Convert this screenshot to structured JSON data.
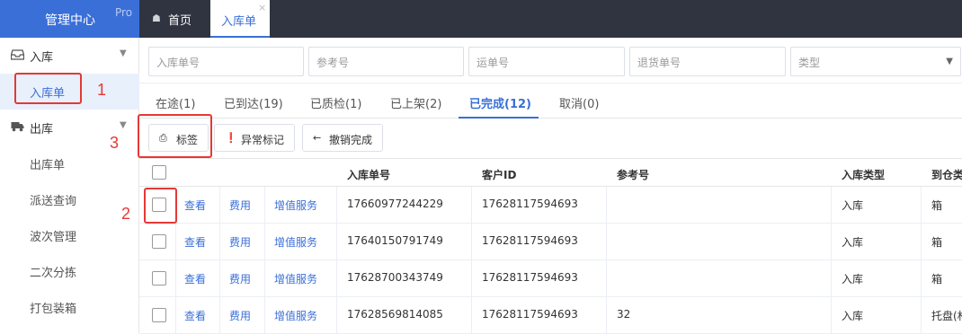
{
  "header": {
    "brand_title": "管理中心",
    "brand_badge": "Pro",
    "tabs": [
      {
        "label": "首页",
        "icon": "home-icon"
      },
      {
        "label": "入库单",
        "active": true,
        "icon": "close-icon"
      }
    ]
  },
  "sidebar": {
    "groups": [
      {
        "label": "入库",
        "icon": "inbox-icon",
        "items": [
          {
            "label": "入库单",
            "active": true
          }
        ]
      },
      {
        "label": "出库",
        "icon": "truck-icon",
        "items": [
          {
            "label": "出库单"
          },
          {
            "label": "派送查询"
          },
          {
            "label": "波次管理"
          },
          {
            "label": "二次分拣"
          },
          {
            "label": "打包装箱"
          }
        ]
      }
    ]
  },
  "filters": [
    {
      "placeholder": "入库单号"
    },
    {
      "placeholder": "参考号"
    },
    {
      "placeholder": "运单号"
    },
    {
      "placeholder": "退货单号"
    },
    {
      "placeholder": "类型",
      "type": "select"
    }
  ],
  "status_tabs": [
    {
      "label": "在途(1)"
    },
    {
      "label": "已到达(19)"
    },
    {
      "label": "已质检(1)"
    },
    {
      "label": "已上架(2)"
    },
    {
      "label": "已完成(12)",
      "active": true
    },
    {
      "label": "取消(0)"
    }
  ],
  "actions": [
    {
      "label": "标签",
      "icon": "printer-icon"
    },
    {
      "label": "异常标记",
      "icon": "alert-icon"
    },
    {
      "label": "撤销完成",
      "icon": "arrow-left-icon"
    }
  ],
  "table": {
    "columns": [
      "入库单号",
      "客户ID",
      "参考号",
      "入库类型",
      "到仓类"
    ],
    "row_links": {
      "view": "查看",
      "fee": "费用",
      "vas": "增值服务"
    },
    "rows": [
      {
        "order_no": "17660977244229",
        "customer_id": "17628117594693",
        "ref_no": "",
        "type": "入库",
        "arrival": "箱"
      },
      {
        "order_no": "17640150791749",
        "customer_id": "17628117594693",
        "ref_no": "",
        "type": "入库",
        "arrival": "箱"
      },
      {
        "order_no": "17628700343749",
        "customer_id": "17628117594693",
        "ref_no": "",
        "type": "入库",
        "arrival": "箱"
      },
      {
        "order_no": "17628569814085",
        "customer_id": "17628117594693",
        "ref_no": "32",
        "type": "入库",
        "arrival": "托盘(杉"
      }
    ]
  },
  "annotations": [
    "1",
    "2",
    "3"
  ],
  "colors": {
    "accent": "#3a6fd8",
    "topbar": "#2f3440",
    "annotation": "#e53935"
  }
}
